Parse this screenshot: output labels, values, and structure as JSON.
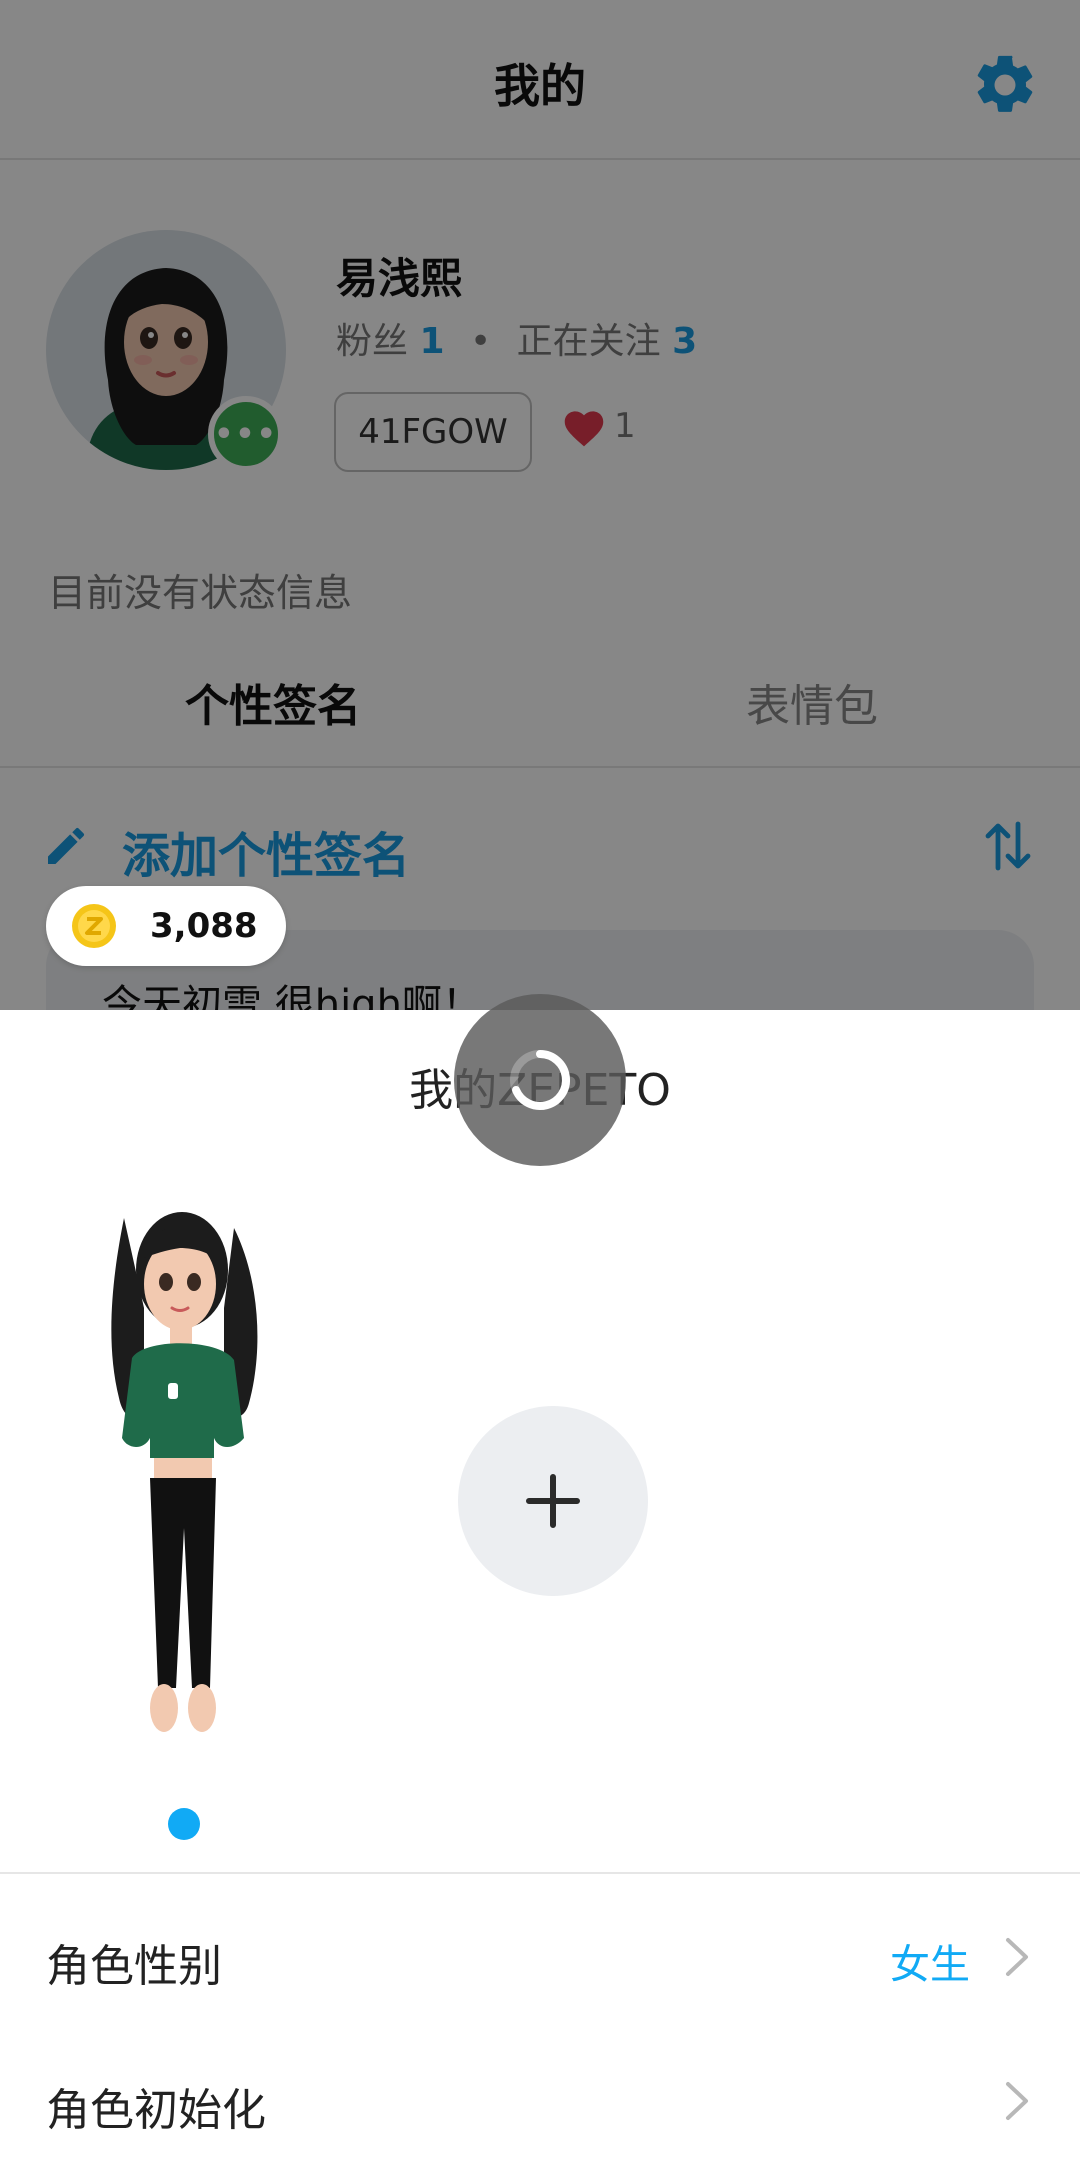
{
  "header": {
    "title": "我的",
    "settings_icon": "gear-icon",
    "accent_color": "#1a9be0"
  },
  "profile": {
    "name": "易浅熙",
    "followers_label": "粉丝",
    "followers_count": "1",
    "following_label": "正在关注",
    "following_count": "3",
    "separator": "•",
    "code": "41FGOW",
    "likes": "1",
    "online_badge": "•••"
  },
  "status": {
    "text": "目前没有状态信息"
  },
  "tabs": [
    {
      "label": "个性签名",
      "active": true
    },
    {
      "label": "表情包",
      "active": false
    }
  ],
  "signature": {
    "add_label": "添加个性签名",
    "entry_text": "今天初雪 很high啊！"
  },
  "coins": {
    "value": "3,088"
  },
  "sheet": {
    "title": "我的ZEPETO",
    "settings": [
      {
        "label": "角色性别",
        "value": "女生"
      },
      {
        "label": "角色初始化",
        "value": ""
      }
    ],
    "active_dot_color": "#11aaf5"
  }
}
